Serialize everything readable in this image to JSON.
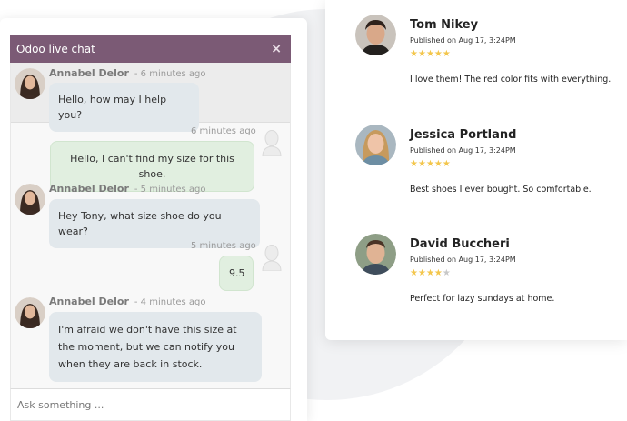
{
  "chat": {
    "title": "Odoo live chat",
    "close_glyph": "×",
    "input_placeholder": "Ask something ...",
    "messages": [
      {
        "author": "Annabel Delor",
        "time": "- 6 minutes ago",
        "text": "Hello, how may I help you?",
        "direction": "in"
      },
      {
        "time": "6 minutes ago",
        "text": "Hello, I can't find my size for this shoe.",
        "direction": "out"
      },
      {
        "author": "Annabel Delor",
        "time": "- 5 minutes ago",
        "text": "Hey Tony, what size shoe do you wear?",
        "direction": "in"
      },
      {
        "time": "5 minutes ago",
        "text": "9.5",
        "direction": "out"
      },
      {
        "author": "Annabel Delor",
        "time": "- 4 minutes ago",
        "text": "I'm afraid we don't have this size at the moment, but we can notify you when they are back in stock.",
        "direction": "in"
      }
    ]
  },
  "reviews": [
    {
      "name": "Tom Nikey",
      "date": "Published on Aug 17, 3:24PM",
      "rating": 5,
      "text": "I love them! The red color fits with everything."
    },
    {
      "name": "Jessica Portland",
      "date": "Published on Aug 17, 3:24PM",
      "rating": 5,
      "text": "Best shoes I ever bought. So comfortable."
    },
    {
      "name": "David Buccheri",
      "date": "Published on Aug 17, 3:24PM",
      "rating": 4,
      "text": "Perfect for lazy sundays at home."
    }
  ],
  "colors": {
    "chat_header": "#7b5a75",
    "incoming_bubble": "#e2e8ec",
    "outgoing_bubble": "#e1efe0",
    "star": "#f3c64c"
  },
  "icons": {
    "agent_avatar": "avatar-icon",
    "visitor_avatar": "visitor-avatar-icon",
    "star": "star-icon",
    "close": "close-icon"
  }
}
